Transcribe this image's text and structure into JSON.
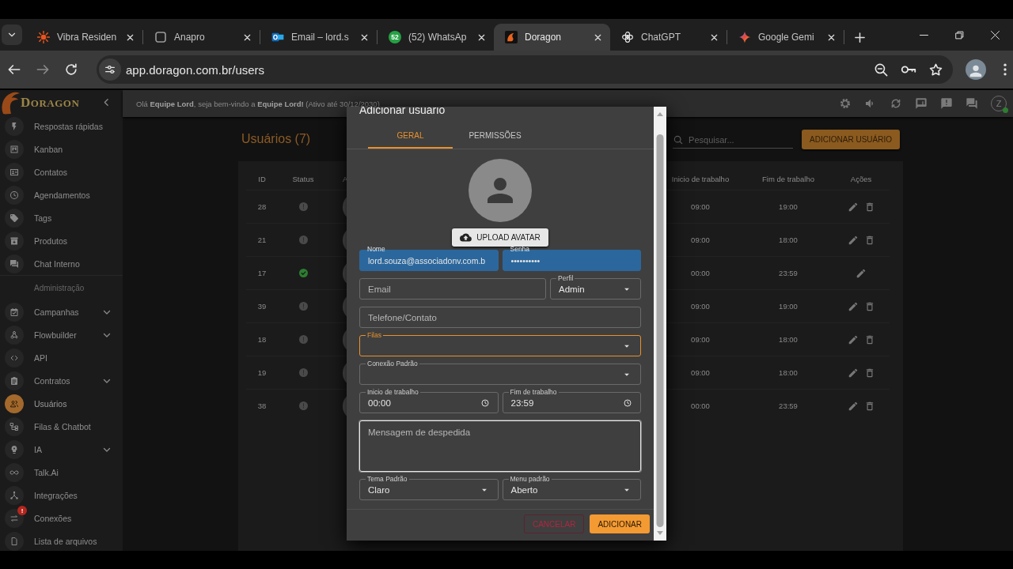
{
  "browser": {
    "tabs": [
      {
        "title": "Vibra Residen",
        "selected": false
      },
      {
        "title": "Anapro",
        "selected": false
      },
      {
        "title": "Email – lord.s",
        "selected": false
      },
      {
        "title": "(52) WhatsAp",
        "badge": "52",
        "selected": false
      },
      {
        "title": "Doragon",
        "selected": true
      },
      {
        "title": "ChatGPT",
        "selected": false
      },
      {
        "title": "Google Gemi",
        "selected": false
      }
    ],
    "url": "app.doragon.com.br/users"
  },
  "sidebar": {
    "logo": "DORAGON",
    "items": [
      {
        "kind": "link",
        "label": "Respostas rápidas",
        "expandable": false,
        "selected": false
      },
      {
        "kind": "link",
        "label": "Kanban",
        "expandable": false,
        "selected": false
      },
      {
        "kind": "link",
        "label": "Contatos",
        "expandable": false,
        "selected": false
      },
      {
        "kind": "link",
        "label": "Agendamentos",
        "expandable": false,
        "selected": false
      },
      {
        "kind": "link",
        "label": "Tags",
        "expandable": false,
        "selected": false
      },
      {
        "kind": "link",
        "label": "Produtos",
        "expandable": false,
        "selected": false
      },
      {
        "kind": "link",
        "label": "Chat Interno",
        "expandable": false,
        "selected": false
      },
      {
        "kind": "section",
        "label": "Administração"
      },
      {
        "kind": "link",
        "label": "Campanhas",
        "expandable": true,
        "selected": false
      },
      {
        "kind": "link",
        "label": "Flowbuilder",
        "expandable": true,
        "selected": false
      },
      {
        "kind": "link",
        "label": "API",
        "expandable": false,
        "selected": false
      },
      {
        "kind": "link",
        "label": "Contratos",
        "expandable": true,
        "selected": false
      },
      {
        "kind": "link",
        "label": "Usuários",
        "expandable": false,
        "selected": true
      },
      {
        "kind": "link",
        "label": "Filas & Chatbot",
        "expandable": false,
        "selected": false
      },
      {
        "kind": "link",
        "label": "IA",
        "expandable": true,
        "selected": false
      },
      {
        "kind": "link",
        "label": "Talk.Ai",
        "expandable": false,
        "selected": false
      },
      {
        "kind": "link",
        "label": "Integrações",
        "expandable": false,
        "selected": false
      },
      {
        "kind": "link",
        "label": "Conexões",
        "expandable": false,
        "selected": false,
        "badge": "!"
      },
      {
        "kind": "link",
        "label": "Lista de arquivos",
        "expandable": false,
        "selected": false
      }
    ]
  },
  "header": {
    "greeting": "Olá **Equipe Lord**, seja bem-vindo a **Equipe Lord!** (Ativo até 30/12/2030)",
    "user_initial": "Z",
    "online": true
  },
  "page": {
    "title": "Usuários (7)",
    "search_placeholder": "Pesquisar...",
    "add_button": "ADICIONAR USUÁRIO"
  },
  "table": {
    "columns": [
      "ID",
      "Status",
      "A",
      "Inicio de trabalho",
      "Fim de trabalho",
      "Ações"
    ],
    "rows": [
      {
        "id": "28",
        "online": false,
        "start": "09:00",
        "end": "19:00",
        "deletable": true
      },
      {
        "id": "21",
        "online": false,
        "start": "09:00",
        "end": "18:00",
        "deletable": true
      },
      {
        "id": "17",
        "online": true,
        "start": "00:00",
        "end": "23:59",
        "deletable": false
      },
      {
        "id": "39",
        "online": false,
        "start": "09:00",
        "end": "19:00",
        "deletable": true
      },
      {
        "id": "18",
        "online": false,
        "start": "09:00",
        "end": "18:00",
        "deletable": true
      },
      {
        "id": "19",
        "online": false,
        "start": "09:00",
        "end": "18:00",
        "deletable": true
      },
      {
        "id": "38",
        "online": false,
        "start": "00:00",
        "end": "23:59",
        "deletable": true
      }
    ]
  },
  "dialog": {
    "title": "Adicionar usuário",
    "tabs": [
      {
        "label": "GERAL",
        "selected": true
      },
      {
        "label": "PERMISSÕES",
        "selected": false
      }
    ],
    "upload_button": "UPLOAD AVATAR",
    "form_rows": [
      [
        {
          "kind": "text",
          "label": "Nome",
          "value": "lord.souza@associadonv.com.b",
          "autofilled": true,
          "focused": false,
          "hovered": false
        },
        {
          "kind": "password",
          "label": "Senha",
          "value": "••••••••••",
          "autofilled": true,
          "focused": false,
          "hovered": false
        }
      ],
      [
        {
          "kind": "text",
          "placeholder": "Email",
          "autofilled": false,
          "focused": false,
          "hovered": false
        },
        {
          "kind": "select",
          "label": "Perfil",
          "value": "Admin",
          "autofilled": false,
          "focused": false,
          "hovered": false
        }
      ],
      [
        {
          "kind": "text",
          "placeholder": "Telefone/Contato",
          "autofilled": false,
          "focused": false,
          "hovered": false
        }
      ],
      [
        {
          "kind": "select",
          "label": "Filas",
          "autofilled": false,
          "focused": true,
          "hovered": false
        }
      ],
      [
        {
          "kind": "select",
          "label": "Conexão Padrão",
          "autofilled": false,
          "focused": false,
          "hovered": false
        }
      ],
      [
        {
          "kind": "time",
          "label": "Inicio de trabalho",
          "value": "00:00",
          "autofilled": false,
          "focused": false,
          "hovered": false
        },
        {
          "kind": "time",
          "label": "Fim de trabalho",
          "value": "23:59",
          "autofilled": false,
          "focused": false,
          "hovered": false
        }
      ],
      [
        {
          "kind": "textarea",
          "placeholder": "Mensagem de despedida",
          "autofilled": false,
          "focused": false,
          "hovered": true
        }
      ],
      [
        {
          "kind": "select",
          "label": "Tema Padrão",
          "value": "Claro",
          "autofilled": false,
          "focused": false,
          "hovered": false
        },
        {
          "kind": "select",
          "label": "Menu padrão",
          "value": "Aberto",
          "autofilled": false,
          "focused": false,
          "hovered": false
        }
      ]
    ],
    "buttons": [
      {
        "kind": "cancel",
        "label": "CANCELAR"
      },
      {
        "kind": "submit",
        "label": "ADICIONAR"
      }
    ]
  }
}
